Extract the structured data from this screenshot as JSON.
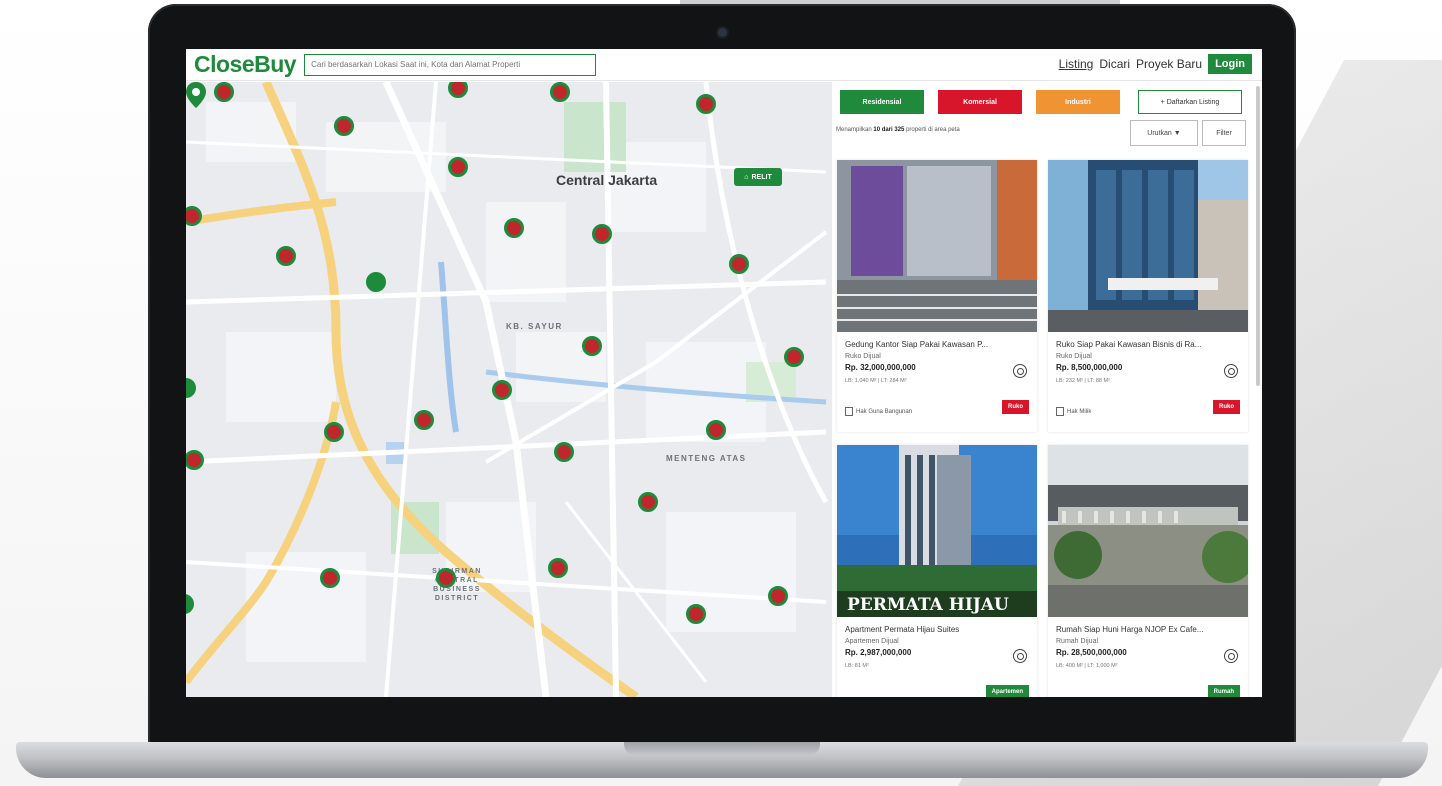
{
  "app": {
    "logo_text": "CloseBuy",
    "search_placeholder": "Cari berdasarkan Lokasi Saat ini, Kota dan Alamat Properti",
    "brand_color": "#1f8a3b"
  },
  "nav": {
    "items": [
      "Listing",
      "Dicari",
      "Proyek Baru"
    ],
    "active": "Listing",
    "login_label": "Login"
  },
  "map": {
    "labels": {
      "central": "Central Jakarta",
      "kb_sayur": "KB. SAYUR",
      "menteng": "MENTENG ATAS",
      "sudirman": "SUDIRMAN CENTRAL BUSINESS DISTRICT"
    },
    "home_tag": "RELIT",
    "marker_colors": {
      "cluster": "#c0272d",
      "ring": "#1e8b3c"
    }
  },
  "filters": {
    "residential": "Residensial",
    "commercial": "Komersial",
    "industrial": "Industri",
    "add_listing": "+ Daftarkan Listing",
    "sort_label": "Urutkan ▼",
    "filter_label": "Filter"
  },
  "summary": {
    "prefix": "Menampilkan",
    "count": "10 dari 325",
    "suffix": "properti di area peta"
  },
  "listings": [
    {
      "title": "Gedung Kantor Siap Pakai Kawasan P...",
      "type": "Ruko Dijual",
      "price": "Rp. 32,000,000,000",
      "size": "LB: 1,040 M² | LT: 284 M²",
      "certificate": "Hak Guna Bangunan",
      "badge": "Ruko",
      "badge_color": "red"
    },
    {
      "title": "Ruko Siap Pakai Kawasan Bisnis di Ra...",
      "type": "Ruko Dijual",
      "price": "Rp. 8,500,000,000",
      "size": "LB: 232 M² | LT: 88 M²",
      "certificate": "Hak Milik",
      "badge": "Ruko",
      "badge_color": "red"
    },
    {
      "title": "Apartment Permata Hijau Suites",
      "type": "Apartemen Dijual",
      "price": "Rp. 2,987,000,000",
      "size": "LB: 81 M²",
      "certificate": "",
      "badge": "Apartemen",
      "badge_color": "green",
      "photo_text": "PERMATA HIJAU"
    },
    {
      "title": "Rumah Siap Huni Harga NJOP Ex Cafe...",
      "type": "Rumah Dijual",
      "price": "Rp. 28,500,000,000",
      "size": "LB: 400 M² | LT: 1,000 M²",
      "certificate": "",
      "badge": "Rumah",
      "badge_color": "green"
    }
  ]
}
